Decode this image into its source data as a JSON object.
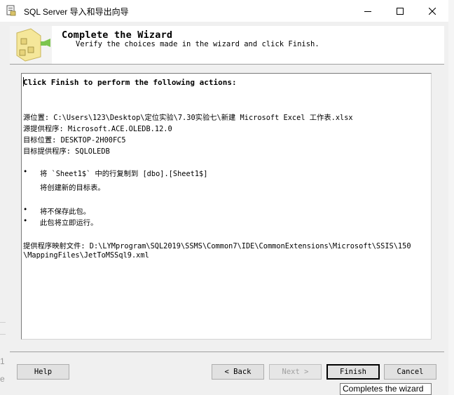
{
  "window": {
    "title": "SQL Server 导入和导出向导"
  },
  "header": {
    "title": "Complete the Wizard",
    "subtitle": "Verify the choices made in the wizard and click Finish."
  },
  "summary": {
    "heading": "Click Finish to perform the following actions:",
    "source_location": "源位置: C:\\Users\\123\\Desktop\\定位实验\\7.30实验七\\新建 Microsoft Excel 工作表.xlsx",
    "source_provider": "源提供程序: Microsoft.ACE.OLEDB.12.0",
    "target_location": "目标位置: DESKTOP-2H00FC5",
    "target_provider": "目标提供程序: SQLOLEDB",
    "bullet_glyph": "•",
    "copy_action": "将 `Sheet1$` 中的行复制到 [dbo].[Sheet1$]",
    "copy_action_sub": "将创建新的目标表。",
    "not_save": "将不保存此包。",
    "run_now": "此包将立即运行。",
    "mapping_file_1": "提供程序映射文件: D:\\LYMprogram\\SQL2019\\SSMS\\Common7\\IDE\\CommonExtensions\\Microsoft\\SSIS\\150",
    "mapping_file_2": "\\MappingFiles\\JetToMSSql9.xml"
  },
  "buttons": {
    "help": "Help",
    "back": "< Back",
    "next": "Next >",
    "finish": "Finish",
    "cancel": "Cancel"
  },
  "tooltip": "Completes the wizard",
  "background": {
    "text1": "1",
    "text2": "e"
  }
}
